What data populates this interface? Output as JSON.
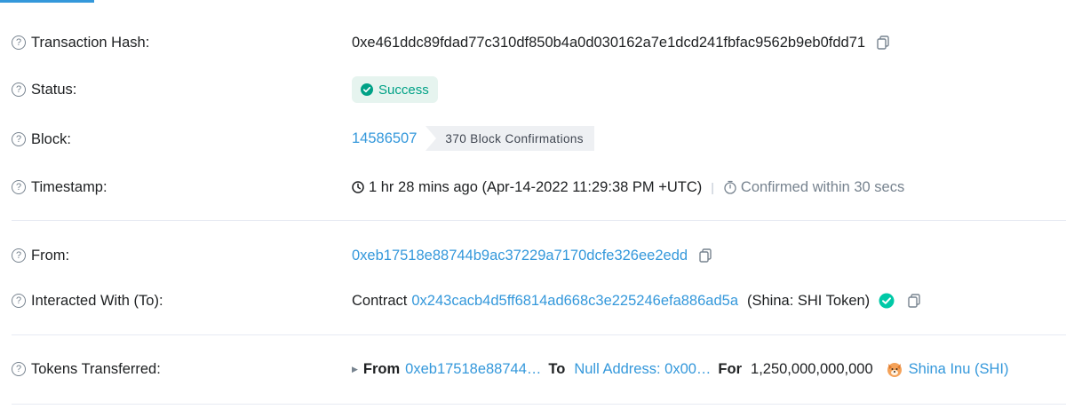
{
  "labels": {
    "tx_hash": "Transaction Hash:",
    "status": "Status:",
    "block": "Block:",
    "timestamp": "Timestamp:",
    "from": "From:",
    "interacted_with": "Interacted With (To):",
    "tokens_transferred": "Tokens Transferred:"
  },
  "help_icon_glyph": "?",
  "tx_hash": "0xe461ddc89fdad77c310df850b4a0d030162a7e1dcd241fbfac9562b9eb0fdd71",
  "status": "Success",
  "block": {
    "number": "14586507",
    "confirmations": "370 Block Confirmations"
  },
  "timestamp": {
    "relative": "1 hr 28 mins ago (Apr-14-2022 11:29:38 PM +UTC)",
    "separator": "|",
    "confirmed": "Confirmed within 30 secs"
  },
  "from_address": "0xeb17518e88744b9ac37229a7170dcfe326ee2edd",
  "interacted": {
    "prefix": "Contract",
    "address": "0x243cacb4d5ff6814ad668c3e225246efa886ad5a",
    "name": "(Shina: SHI Token)"
  },
  "tokens": {
    "from_label": "From",
    "from_address": "0xeb17518e88744…",
    "to_label": "To",
    "to_address": "Null Address: 0x00…",
    "for_label": "For",
    "amount": "1,250,000,000,000",
    "token_name": "Shina Inu (SHI)"
  },
  "colors": {
    "link": "#3498db",
    "success": "#00a186",
    "success_bg": "#e6f4ef",
    "muted": "#77838f"
  }
}
